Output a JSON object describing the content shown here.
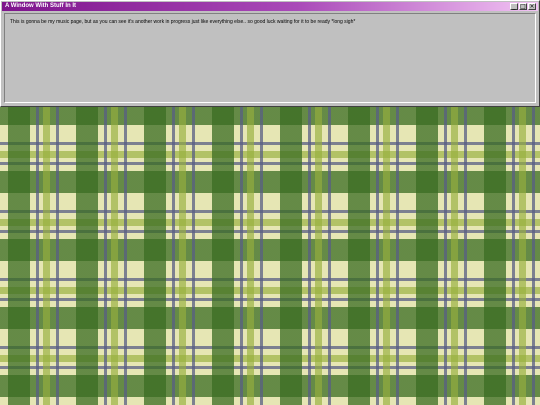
{
  "window": {
    "title": "A Window With Stuff In It",
    "body_text": "This is gonna be my music page, but as you can see it's another work in progress just like everything else.. so good luck waiting for it to be ready *long sigh*"
  },
  "titlebar_buttons": {
    "minimize": "_",
    "maximize": "□",
    "close": "×"
  },
  "colors": {
    "titlebar_start": "#7e148c",
    "titlebar_end": "#f2c4f4",
    "window_face": "#c0c0c0",
    "plaid_base": "#e6e6b4",
    "plaid_green": "#3a6c22"
  }
}
